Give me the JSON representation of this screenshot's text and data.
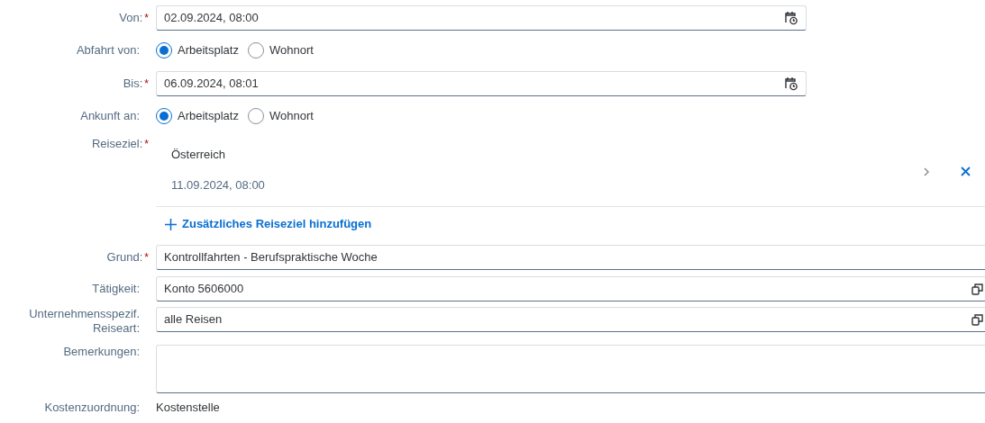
{
  "rows": [
    {
      "kind": "date",
      "label": "Von:",
      "marker": "*",
      "value": "02.09.2024, 08:00"
    },
    {
      "kind": "radio",
      "label": "Abfahrt von:",
      "options": [
        {
          "label": "Arbeitsplatz",
          "selected": true
        },
        {
          "label": "Wohnort",
          "selected": false
        }
      ]
    },
    {
      "kind": "date",
      "label": "Bis:",
      "marker": "*",
      "value": "06.09.2024, 08:01"
    },
    {
      "kind": "radio",
      "label": "Ankunft an:",
      "options": [
        {
          "label": "Arbeitsplatz",
          "selected": true
        },
        {
          "label": "Wohnort",
          "selected": false
        }
      ]
    },
    {
      "kind": "destination",
      "label": "Reiseziel:",
      "marker": "*",
      "country": "Österreich",
      "date": "11.09.2024, 08:00",
      "add_link": "Zusätzliches Reiseziel hinzufügen"
    },
    {
      "kind": "text",
      "label": "Grund:",
      "marker": "*",
      "value": "Kontrollfahrten - Berufspraktische Woche"
    },
    {
      "kind": "valuehelp",
      "label": "Tätigkeit:",
      "value": "Konto 5606000"
    },
    {
      "kind": "valuehelp",
      "label": "Unternehmensspezif. Reiseart:",
      "value": "alle Reisen"
    },
    {
      "kind": "textarea",
      "label": "Bemerkungen:"
    },
    {
      "kind": "display",
      "label": "Kostenzuordnung:",
      "value": "Kostenstelle"
    }
  ]
}
